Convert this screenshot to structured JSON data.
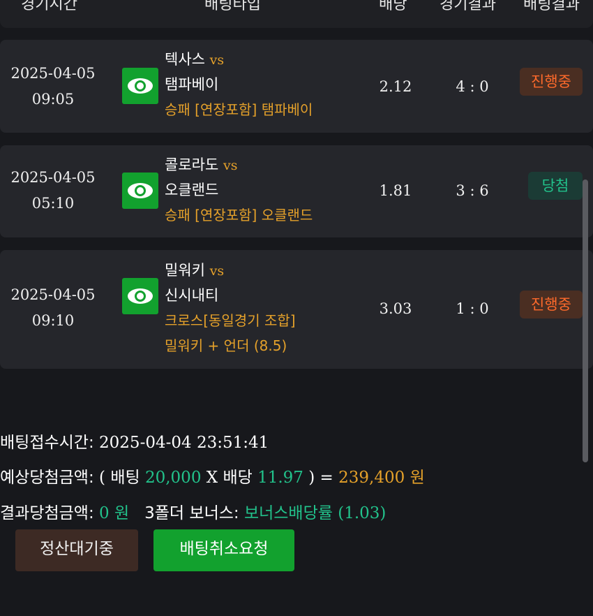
{
  "header": {
    "col_time": "경기시간",
    "col_bet": "배팅타입",
    "col_odds": "배당",
    "col_result": "경기결과",
    "col_bet_result": "배팅결과"
  },
  "bets": [
    {
      "date": "2025-04-05",
      "time": "09:05",
      "home": "텍사스",
      "vs": "vs",
      "away": "탬파베이",
      "pick_lines": [
        "승패 [연장포함] 탬파베이"
      ],
      "odds": "2.12",
      "score": "4 : 0",
      "status": "진행중",
      "status_type": "pending"
    },
    {
      "date": "2025-04-05",
      "time": "05:10",
      "home": "콜로라도",
      "vs": "vs",
      "away": "오클랜드",
      "pick_lines": [
        "승패 [연장포함] 오클랜드"
      ],
      "odds": "1.81",
      "score": "3 : 6",
      "status": "당첨",
      "status_type": "won"
    },
    {
      "date": "2025-04-05",
      "time": "09:10",
      "home": "밀워키",
      "vs": "vs",
      "away": "신시내티",
      "pick_lines": [
        "크로스[동일경기 조합]",
        "밀워키 + 언더 (8.5)"
      ],
      "odds": "3.03",
      "score": "1 : 0",
      "status": "진행중",
      "status_type": "pending"
    }
  ],
  "summary": {
    "accept_time_label": "배팅접수시간: ",
    "accept_time": "2025-04-04 23:51:41",
    "expected_label": "예상당첨금액: ",
    "paren_open": "( ",
    "bet_label": "배팅 ",
    "bet_amount": "20,000",
    "times": " X ",
    "odds_label": "배당 ",
    "total_odds": "11.97",
    "paren_close": " ) = ",
    "expected_amount": "239,400 원",
    "result_label": "결과당첨금액: ",
    "result_amount": "0 원",
    "bonus_label": "3폴더 보너스: ",
    "bonus_value": "보너스배당률 (1.03)"
  },
  "buttons": {
    "settle_wait": "정산대기중",
    "cancel_request": "배팅취소요청"
  },
  "colors": {
    "accent_green": "#12a12e",
    "text_orange": "#e5a12a",
    "text_teal": "#22c28b",
    "status_pending": "#ff6a2b"
  },
  "icons": {
    "view": "eye-icon"
  }
}
